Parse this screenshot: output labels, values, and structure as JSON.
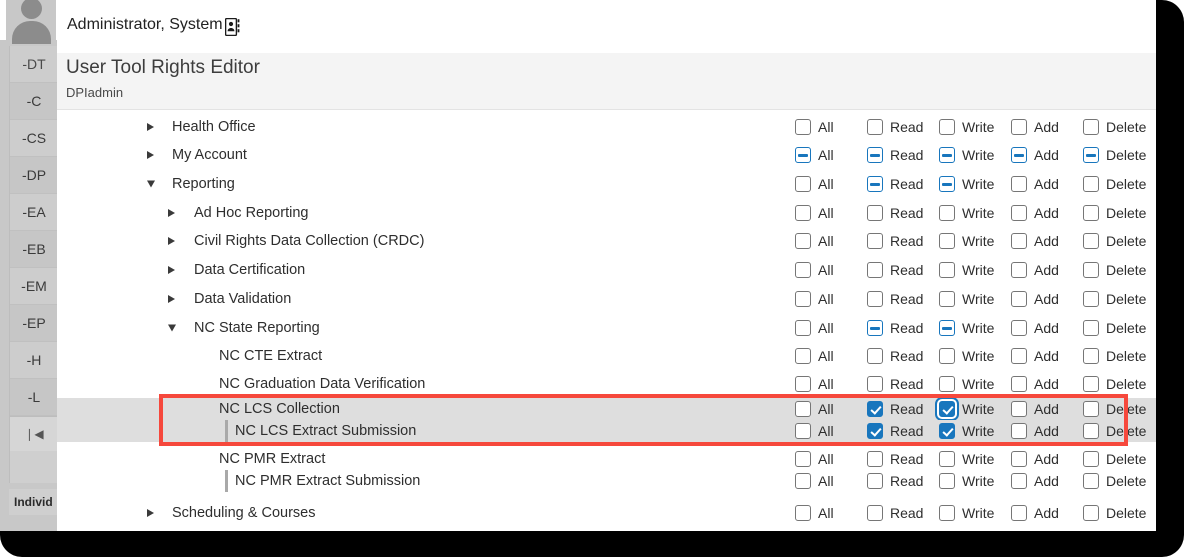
{
  "window": {
    "frame_color": "#000000",
    "content_bg": "#ffffff"
  },
  "userbar": {
    "user_name": "Administrator, System",
    "avatar_icon": "person-avatar-icon",
    "contact_card_icon": "contact-card-icon"
  },
  "header": {
    "title": "User Tool Rights Editor",
    "subtitle": "DPIadmin",
    "bg_color": "#f4f4f4"
  },
  "sidebar": {
    "items": [
      {
        "label": "-DT"
      },
      {
        "label": "-C"
      },
      {
        "label": "-CS"
      },
      {
        "label": "-DP"
      },
      {
        "label": "-EA"
      },
      {
        "label": "-EB"
      },
      {
        "label": "-EM"
      },
      {
        "label": "-EP"
      },
      {
        "label": "-H"
      },
      {
        "label": "-L"
      }
    ],
    "collapse_icon": "collapse-left-icon",
    "bottom_label": "Individ"
  },
  "permission_columns": [
    "All",
    "Read",
    "Write",
    "Add",
    "Delete"
  ],
  "colors": {
    "checkbox_checked": "#1876bd",
    "checkbox_partial": "#1876bd",
    "highlight_row": "#dedede",
    "annotation_red": "#f6483c"
  },
  "annotation": {
    "shape": "rectangle",
    "color": "#f6483c",
    "covers_rows": [
      "NC LCS Collection",
      "NC LCS Extract Submission"
    ]
  },
  "tree_rows": [
    {
      "label": "Health Office",
      "depth": 0,
      "twisty": "closed",
      "indent_bar": false,
      "highlight": false,
      "rights": [
        "off",
        "off",
        "off",
        "off",
        "off"
      ]
    },
    {
      "label": "My Account",
      "depth": 0,
      "twisty": "closed",
      "indent_bar": false,
      "highlight": false,
      "rights": [
        "partial",
        "partial",
        "partial",
        "partial",
        "partial"
      ]
    },
    {
      "label": "Reporting",
      "depth": 0,
      "twisty": "open",
      "indent_bar": false,
      "highlight": false,
      "rights": [
        "off",
        "partial",
        "partial",
        "off",
        "off"
      ]
    },
    {
      "label": "Ad Hoc Reporting",
      "depth": 1,
      "twisty": "closed",
      "indent_bar": false,
      "highlight": false,
      "rights": [
        "off",
        "off",
        "off",
        "off",
        "off"
      ]
    },
    {
      "label": "Civil Rights Data Collection (CRDC)",
      "depth": 1,
      "twisty": "closed",
      "indent_bar": false,
      "highlight": false,
      "rights": [
        "off",
        "off",
        "off",
        "off",
        "off"
      ]
    },
    {
      "label": "Data Certification",
      "depth": 1,
      "twisty": "closed",
      "indent_bar": false,
      "highlight": false,
      "rights": [
        "off",
        "off",
        "off",
        "off",
        "off"
      ]
    },
    {
      "label": "Data Validation",
      "depth": 1,
      "twisty": "closed",
      "indent_bar": false,
      "highlight": false,
      "rights": [
        "off",
        "off",
        "off",
        "off",
        "off"
      ]
    },
    {
      "label": "NC State Reporting",
      "depth": 1,
      "twisty": "open",
      "indent_bar": false,
      "highlight": false,
      "rights": [
        "off",
        "partial",
        "partial",
        "off",
        "off"
      ]
    },
    {
      "label": "NC CTE Extract",
      "depth": 2,
      "twisty": "none",
      "indent_bar": false,
      "highlight": false,
      "rights": [
        "off",
        "off",
        "off",
        "off",
        "off"
      ]
    },
    {
      "label": "NC Graduation Data Verification",
      "depth": 2,
      "twisty": "none",
      "indent_bar": false,
      "highlight": false,
      "rights": [
        "off",
        "off",
        "off",
        "off",
        "off"
      ]
    },
    {
      "label": "NC LCS Collection",
      "depth": 2,
      "twisty": "none",
      "indent_bar": false,
      "highlight": true,
      "rights": [
        "off",
        "on",
        "on",
        "off",
        "off"
      ],
      "focused_right": "Write"
    },
    {
      "label": "NC LCS Extract Submission",
      "depth": 3,
      "twisty": "none",
      "indent_bar": true,
      "highlight": true,
      "rights": [
        "off",
        "on",
        "on",
        "off",
        "off"
      ]
    },
    {
      "label": "NC PMR Extract",
      "depth": 2,
      "twisty": "none",
      "indent_bar": false,
      "highlight": false,
      "rights": [
        "off",
        "off",
        "off",
        "off",
        "off"
      ]
    },
    {
      "label": "NC PMR Extract Submission",
      "depth": 3,
      "twisty": "none",
      "indent_bar": true,
      "highlight": false,
      "rights": [
        "off",
        "off",
        "off",
        "off",
        "off"
      ]
    },
    {
      "label": "Scheduling & Courses",
      "depth": 0,
      "twisty": "closed",
      "indent_bar": false,
      "highlight": false,
      "rights": [
        "off",
        "off",
        "off",
        "off",
        "off"
      ]
    }
  ]
}
